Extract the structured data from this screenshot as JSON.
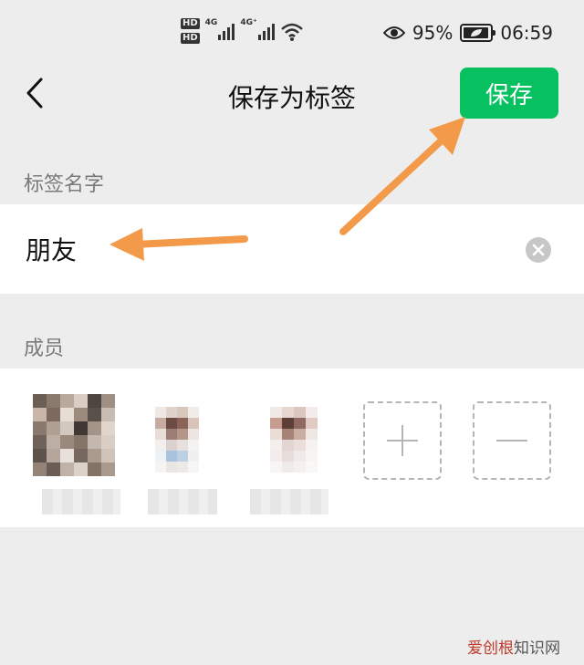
{
  "status_bar": {
    "hd1": "HD",
    "hd2": "HD",
    "net1": "4G",
    "net2": "4G⁺",
    "battery_percent": "95%",
    "battery_level": 0.95,
    "time": "06:59",
    "icons": [
      "signal-icon",
      "wifi-icon",
      "eye-icon",
      "battery-icon"
    ]
  },
  "nav": {
    "back_icon": "chevron-left-icon",
    "title": "保存为标签",
    "save_label": "保存"
  },
  "tag_name": {
    "section_label": "标签名字",
    "value": "朋友",
    "clear_icon": "clear-circle-icon"
  },
  "members": {
    "section_label": "成员",
    "items": [
      {
        "avatar": "blurred-avatar"
      },
      {
        "avatar": "blurred-avatar"
      },
      {
        "avatar": "blurred-avatar"
      }
    ],
    "add_icon": "plus-icon",
    "remove_icon": "minus-icon"
  },
  "watermark": {
    "brand": "爱创根",
    "suffix": "知识网"
  },
  "colors": {
    "accent": "#07c160",
    "annotation_arrow": "#f29a4a",
    "background": "#ededed"
  }
}
